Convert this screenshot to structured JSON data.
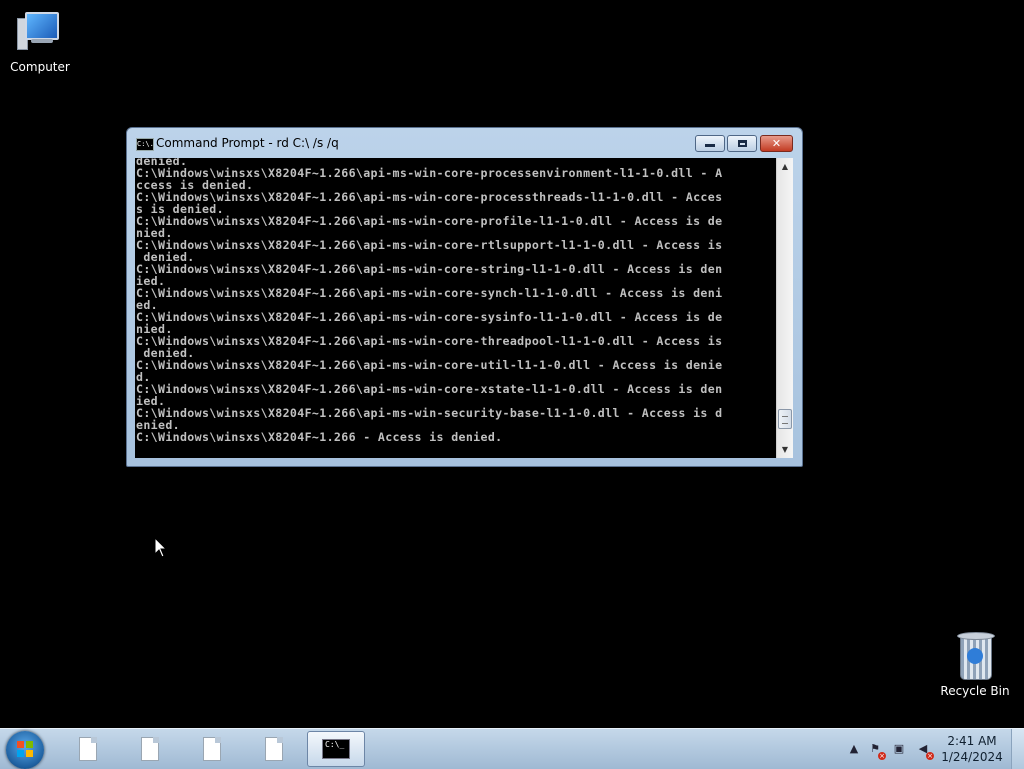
{
  "desktop": {
    "icons": [
      {
        "label": "Computer",
        "icon": "computer-icon"
      },
      {
        "label": "Recycle Bin",
        "icon": "recycle-bin-icon"
      }
    ]
  },
  "cmd_window": {
    "title": "Command Prompt - rd  C:\\ /s /q",
    "title_icon_text": "C:\\.",
    "lines": [
      "denied.",
      "C:\\Windows\\winsxs\\X8204F~1.266\\api-ms-win-core-processenvironment-l1-1-0.dll - A",
      "ccess is denied.",
      "C:\\Windows\\winsxs\\X8204F~1.266\\api-ms-win-core-processthreads-l1-1-0.dll - Acces",
      "s is denied.",
      "C:\\Windows\\winsxs\\X8204F~1.266\\api-ms-win-core-profile-l1-1-0.dll - Access is de",
      "nied.",
      "C:\\Windows\\winsxs\\X8204F~1.266\\api-ms-win-core-rtlsupport-l1-1-0.dll - Access is",
      " denied.",
      "C:\\Windows\\winsxs\\X8204F~1.266\\api-ms-win-core-string-l1-1-0.dll - Access is den",
      "ied.",
      "C:\\Windows\\winsxs\\X8204F~1.266\\api-ms-win-core-synch-l1-1-0.dll - Access is deni",
      "ed.",
      "C:\\Windows\\winsxs\\X8204F~1.266\\api-ms-win-core-sysinfo-l1-1-0.dll - Access is de",
      "nied.",
      "C:\\Windows\\winsxs\\X8204F~1.266\\api-ms-win-core-threadpool-l1-1-0.dll - Access is",
      " denied.",
      "C:\\Windows\\winsxs\\X8204F~1.266\\api-ms-win-core-util-l1-1-0.dll - Access is denie",
      "d.",
      "C:\\Windows\\winsxs\\X8204F~1.266\\api-ms-win-core-xstate-l1-1-0.dll - Access is den",
      "ied.",
      "C:\\Windows\\winsxs\\X8204F~1.266\\api-ms-win-security-base-l1-1-0.dll - Access is d",
      "enied.",
      "C:\\Windows\\winsxs\\X8204F~1.266 - Access is denied."
    ],
    "scrollbar_position": 0.95
  },
  "taskbar": {
    "items": [
      {
        "icon": "document-icon"
      },
      {
        "icon": "document-icon"
      },
      {
        "icon": "document-icon"
      },
      {
        "icon": "document-icon"
      },
      {
        "icon": "command-prompt-icon",
        "active": true
      }
    ],
    "cmd_icon_text": "C:\\_",
    "clock": {
      "time": "2:41 AM",
      "date": "1/24/2024"
    }
  },
  "colors": {
    "console_text": "#c0c0c0",
    "console_bg": "#000000",
    "desktop_bg": "#000000"
  }
}
